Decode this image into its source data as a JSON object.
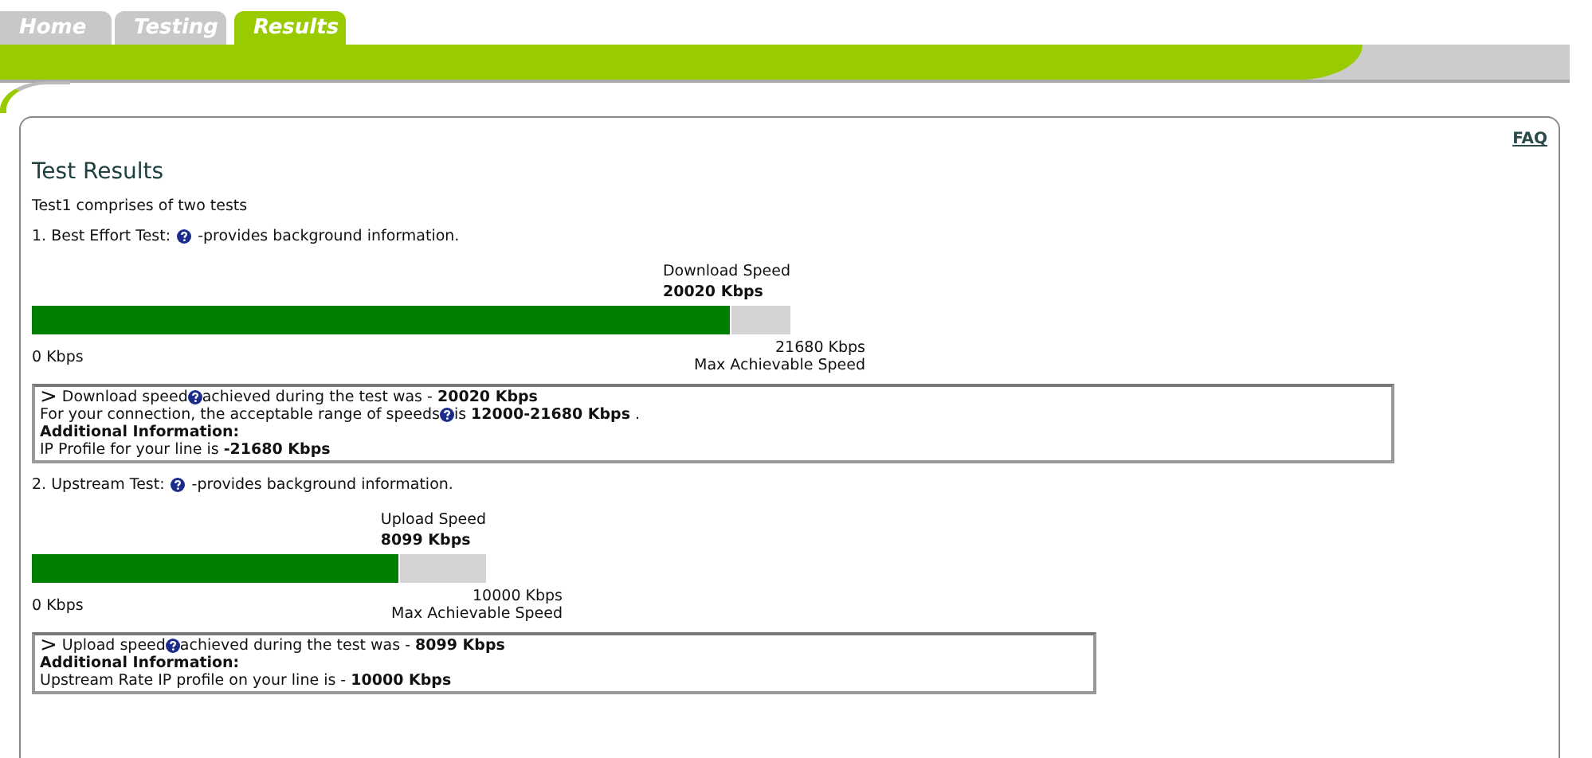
{
  "tabs": [
    {
      "label": "Home",
      "selected": false
    },
    {
      "label": "Testing",
      "selected": false
    },
    {
      "label": "Results",
      "selected": true
    }
  ],
  "faq": "FAQ",
  "title": "Test Results",
  "intro": "Test1 comprises of two tests",
  "tests": [
    {
      "heading": "1. Best Effort Test:",
      "heading_suffix": "-provides background information.",
      "speed_label": "Download Speed",
      "speed_value": "20020 Kbps",
      "level": 0.923,
      "min_label": "0 Kbps",
      "max_label": "21680 Kbps",
      "max_caption": "Max Achievable Speed",
      "info": [
        [
          {
            "kind": "arrow",
            "text": ">"
          },
          {
            "kind": "text",
            "text": "Download speed"
          },
          {
            "kind": "help"
          },
          {
            "kind": "text",
            "text": "achieved during the test was - **20020 Kbps**"
          }
        ],
        [
          {
            "kind": "text",
            "text": "For your connection, the acceptable range of speeds"
          },
          {
            "kind": "help"
          },
          {
            "kind": "text",
            "text": "is **12000-21680 Kbps** ."
          }
        ],
        [
          {
            "kind": "bold",
            "text": "Additional Information:"
          }
        ],
        [
          {
            "kind": "text",
            "text": "IP Profile for your line is **-21680 Kbps**"
          }
        ]
      ]
    },
    {
      "heading": "2. Upstream Test:",
      "heading_suffix": "-provides background information.",
      "speed_label": "Upload Speed",
      "speed_value": "8099 Kbps",
      "level": 0.81,
      "min_label": "0 Kbps",
      "max_label": "10000 Kbps",
      "max_caption": "Max Achievable Speed",
      "info": [
        [
          {
            "kind": "arrow",
            "text": ">"
          },
          {
            "kind": "text",
            "text": "Upload speed"
          },
          {
            "kind": "help"
          },
          {
            "kind": "text",
            "text": "achieved during the test was - **8099 Kbps**"
          }
        ],
        [
          {
            "kind": "bold",
            "text": "Additional Information:"
          }
        ],
        [
          {
            "kind": "text",
            "text": "Upstream Rate IP profile on your line is - **10000 Kbps**"
          }
        ]
      ]
    }
  ]
}
